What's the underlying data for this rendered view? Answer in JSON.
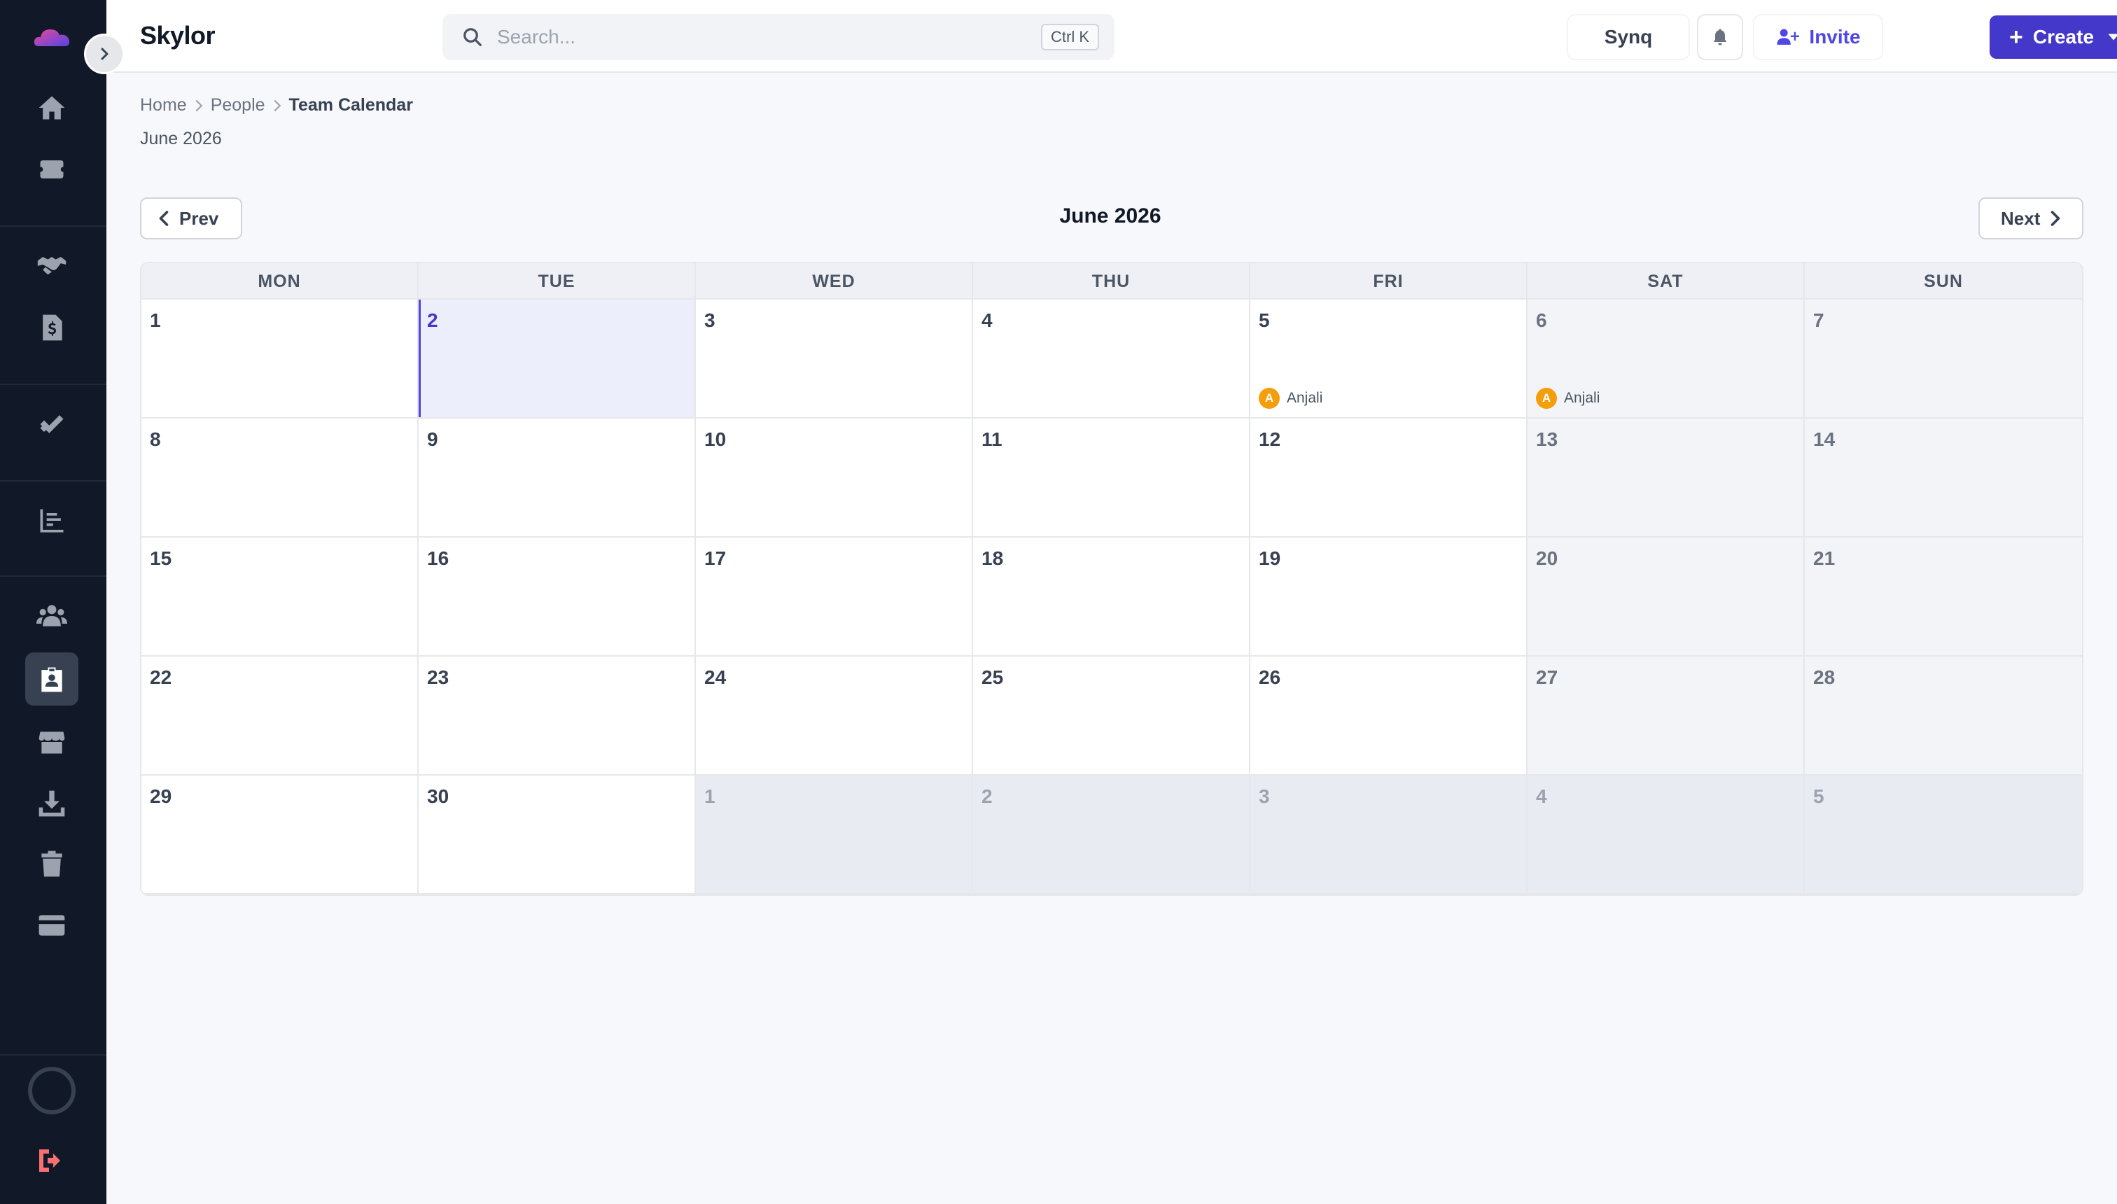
{
  "app": {
    "title": "Skylor"
  },
  "header": {
    "search_placeholder": "Search...",
    "search_shortcut": "Ctrl K",
    "synq_label": "Synq",
    "invite_label": "Invite",
    "create_label": "Create"
  },
  "sidebar": {
    "items": [
      {
        "icon": "home-icon"
      },
      {
        "icon": "inbox-icon"
      },
      {
        "icon": "handshake-icon"
      },
      {
        "icon": "invoice-icon"
      },
      {
        "icon": "checkmark-icon"
      },
      {
        "icon": "reports-icon"
      },
      {
        "icon": "team-icon"
      },
      {
        "icon": "id-badge-icon",
        "active": true
      },
      {
        "icon": "store-icon"
      },
      {
        "icon": "download-icon"
      },
      {
        "icon": "trash-icon"
      },
      {
        "icon": "credit-card-icon"
      }
    ]
  },
  "breadcrumb": {
    "items": [
      "Home",
      "People"
    ],
    "current": "Team Calendar"
  },
  "page": {
    "subtitle": "June 2026",
    "prev_label": "Prev",
    "next_label": "Next",
    "calendar_title": "June 2026"
  },
  "calendar": {
    "weekdays": [
      "MON",
      "TUE",
      "WED",
      "THU",
      "FRI",
      "SAT",
      "SUN"
    ],
    "cells": [
      {
        "day": "1"
      },
      {
        "day": "2",
        "today": true
      },
      {
        "day": "3"
      },
      {
        "day": "4"
      },
      {
        "day": "5",
        "event": {
          "initial": "A",
          "name": "Anjali"
        }
      },
      {
        "day": "6",
        "weekend": true,
        "event": {
          "initial": "A",
          "name": "Anjali"
        }
      },
      {
        "day": "7",
        "weekend": true
      },
      {
        "day": "8"
      },
      {
        "day": "9"
      },
      {
        "day": "10"
      },
      {
        "day": "11"
      },
      {
        "day": "12"
      },
      {
        "day": "13",
        "weekend": true
      },
      {
        "day": "14",
        "weekend": true
      },
      {
        "day": "15"
      },
      {
        "day": "16"
      },
      {
        "day": "17"
      },
      {
        "day": "18"
      },
      {
        "day": "19"
      },
      {
        "day": "20",
        "weekend": true
      },
      {
        "day": "21",
        "weekend": true
      },
      {
        "day": "22"
      },
      {
        "day": "23"
      },
      {
        "day": "24"
      },
      {
        "day": "25"
      },
      {
        "day": "26"
      },
      {
        "day": "27",
        "weekend": true
      },
      {
        "day": "28",
        "weekend": true
      },
      {
        "day": "29"
      },
      {
        "day": "30"
      },
      {
        "day": "1",
        "outside": true
      },
      {
        "day": "2",
        "outside": true
      },
      {
        "day": "3",
        "outside": true
      },
      {
        "day": "4",
        "outside": true
      },
      {
        "day": "5",
        "outside": true
      }
    ]
  },
  "colors": {
    "accent": "#4338ca",
    "sidebar_bg": "#111827",
    "event_avatar": "#f59e0b"
  }
}
